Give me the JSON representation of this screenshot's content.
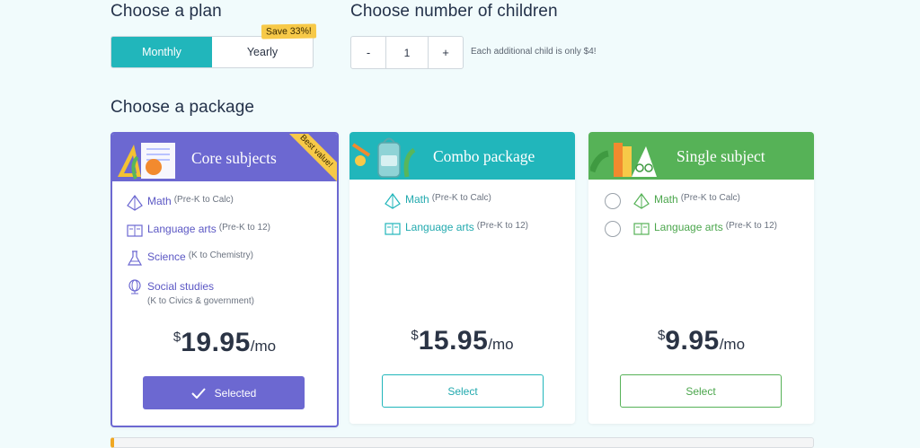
{
  "plan": {
    "title": "Choose a plan",
    "monthly_label": "Monthly",
    "yearly_label": "Yearly",
    "save_badge": "Save 33%!",
    "selected": "Monthly"
  },
  "children": {
    "title": "Choose number of children",
    "minus": "-",
    "value": "1",
    "plus": "+",
    "note": "Each additional child is only $4!"
  },
  "package": {
    "title": "Choose a package",
    "cards": [
      {
        "title": "Core subjects",
        "ribbon": "Best value!",
        "subjects": [
          {
            "name": "Math",
            "range": "(Pre-K to Calc)",
            "icon": "pyramid-icon"
          },
          {
            "name": "Language arts",
            "range": "(Pre-K to 12)",
            "icon": "book-icon"
          },
          {
            "name": "Science",
            "range": "(K to Chemistry)",
            "icon": "flask-icon"
          },
          {
            "name": "Social studies",
            "range": "(K to Civics & government)",
            "icon": "globe-icon"
          }
        ],
        "currency": "$",
        "price": "19.95",
        "per": "/mo",
        "button": "Selected"
      },
      {
        "title": "Combo package",
        "subjects": [
          {
            "name": "Math",
            "range": "(Pre-K to Calc)",
            "icon": "pyramid-icon"
          },
          {
            "name": "Language arts",
            "range": "(Pre-K to 12)",
            "icon": "book-icon"
          }
        ],
        "currency": "$",
        "price": "15.95",
        "per": "/mo",
        "button": "Select"
      },
      {
        "title": "Single subject",
        "subjects": [
          {
            "name": "Math",
            "range": "(Pre-K to Calc)",
            "icon": "pyramid-icon"
          },
          {
            "name": "Language arts",
            "range": "(Pre-K to 12)",
            "icon": "book-icon"
          }
        ],
        "currency": "$",
        "price": "9.95",
        "per": "/mo",
        "button": "Select"
      }
    ]
  },
  "colors": {
    "core": "#6c68d1",
    "combo": "#21b6bb",
    "single": "#56b257",
    "badge": "#f7c948"
  }
}
